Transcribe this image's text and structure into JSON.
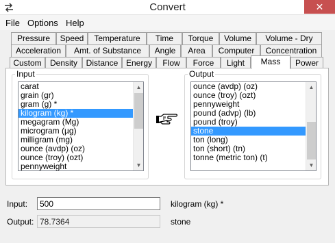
{
  "window": {
    "title": "Convert",
    "close_glyph": "✕"
  },
  "menu": [
    "File",
    "Options",
    "Help"
  ],
  "tabs": {
    "row1": [
      "Pressure",
      "Speed",
      "Temperature",
      "Time",
      "Torque",
      "Volume",
      "Volume - Dry"
    ],
    "row2": [
      "Acceleration",
      "Amt. of Substance",
      "Angle",
      "Area",
      "Computer",
      "Concentration"
    ],
    "row3": [
      "Custom",
      "Density",
      "Distance",
      "Energy",
      "Flow",
      "Force",
      "Light",
      "Mass",
      "Power"
    ],
    "active": "Mass"
  },
  "input_group": {
    "label": "Input",
    "items": [
      "carat",
      "grain (gr)",
      "gram (g) *",
      "kilogram (kg) *",
      "megagram (Mg)",
      "microgram (µg)",
      "milligram (mg)",
      "ounce (avdp) (oz)",
      "ounce (troy) (ozt)",
      "pennyweight"
    ],
    "selected": "kilogram (kg) *"
  },
  "output_group": {
    "label": "Output",
    "items": [
      "ounce (avdp) (oz)",
      "ounce (troy) (ozt)",
      "pennyweight",
      "pound (advp) (lb)",
      "pound (troy)",
      "stone",
      "ton (long)",
      "ton (short) (tn)",
      "tonne (metric ton) (t)"
    ],
    "selected": "stone"
  },
  "pointer_icon": "pointing-hand-icon",
  "colors": {
    "selection": "#3399ff",
    "close_button": "#c75050"
  },
  "input": {
    "label": "Input:",
    "value": "500",
    "unit": "kilogram (kg) *"
  },
  "output": {
    "label": "Output:",
    "value": "78.7364",
    "unit": "stone"
  }
}
